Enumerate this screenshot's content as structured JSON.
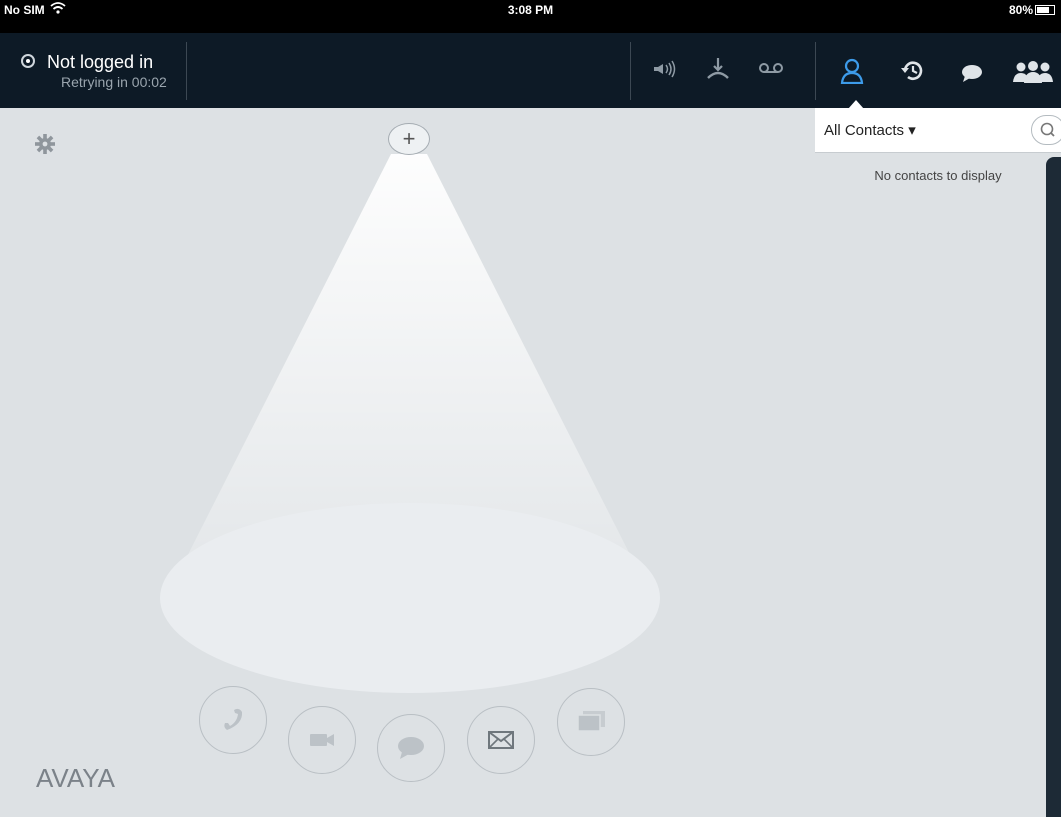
{
  "status_bar": {
    "carrier": "No SIM",
    "time": "3:08 PM",
    "battery": "80%"
  },
  "login": {
    "title": "Not logged in",
    "subtitle": "Retrying in 00:02"
  },
  "top_bar_icons": [
    "speaker-icon",
    "transfer-icon",
    "voicemail-icon",
    "contacts-icon",
    "history-icon",
    "messages-icon",
    "groups-icon"
  ],
  "contacts": {
    "filter": "All Contacts ▾",
    "empty_message": "No contacts to display"
  },
  "stage": {
    "add_label": "+",
    "actions": [
      "phone-icon",
      "video-icon",
      "chat-icon",
      "email-icon",
      "share-screen-icon"
    ]
  },
  "brand": {
    "logo": "AVAYA"
  },
  "colors": {
    "topbar": "#0d1a26",
    "accent": "#3d9be9",
    "background": "#dde1e4"
  }
}
